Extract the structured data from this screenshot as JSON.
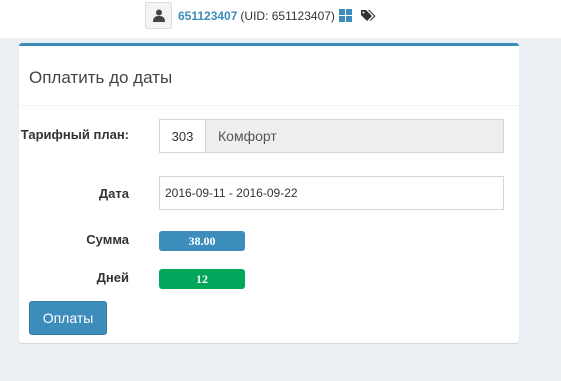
{
  "header": {
    "user_id_link": "651123407",
    "uid_text": "(UID: 651123407)"
  },
  "panel": {
    "title": "Оплатить до даты",
    "tariff": {
      "label": "Тарифный план:",
      "code": "303",
      "name": "Комфорт"
    },
    "date": {
      "label": "Дата",
      "value": "2016-09-11 - 2016-09-22"
    },
    "sum": {
      "label": "Сумма",
      "value": "38.00"
    },
    "days": {
      "label": "Дней",
      "value": "12"
    },
    "pay_button": "Оплаты"
  },
  "colors": {
    "primary": "#3c8dbc",
    "success": "#00a65a",
    "background": "#ecf0f5"
  }
}
